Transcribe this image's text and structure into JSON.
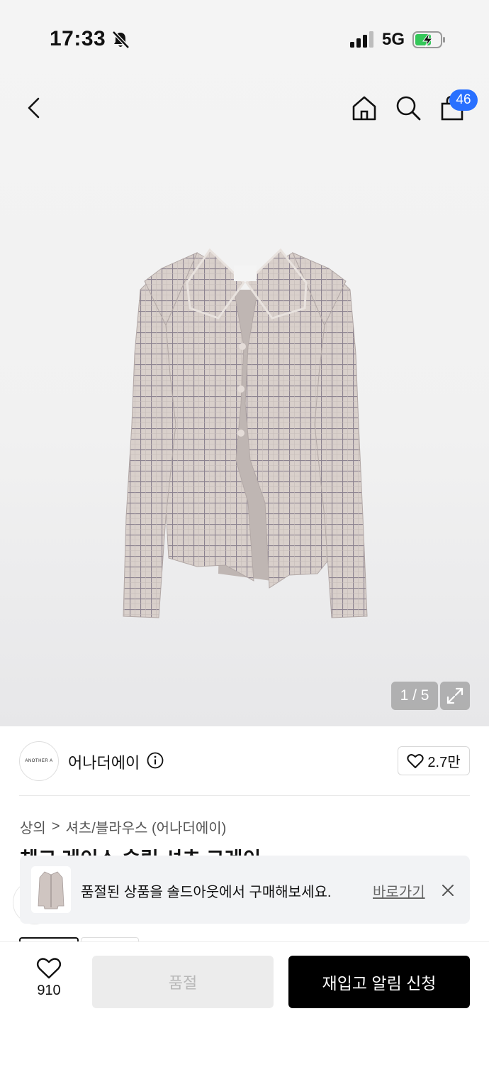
{
  "status_bar": {
    "time": "17:33",
    "network": "5G"
  },
  "header": {
    "cart_count": "46"
  },
  "gallery": {
    "counter": "1 / 5"
  },
  "brand": {
    "logo_text": "ANOTHER A",
    "name": "어나더에이",
    "like_count": "2.7만"
  },
  "breadcrumb": {
    "items": [
      "상의",
      "셔츠/블라우스 (어나더에이)"
    ],
    "separator": ">"
  },
  "product": {
    "title": "체크 레이스 슬림 셔츠 그레이"
  },
  "banner": {
    "message": "품절된 상품을 솔드아웃에서 구매해보세요.",
    "link": "바로가기"
  },
  "bottom_bar": {
    "wish_count": "910",
    "soldout_label": "품절",
    "restock_label": "재입고 알림 신청"
  },
  "colors": {
    "badge": "#2970ff",
    "primary_button": "#000000",
    "disabled_button": "#ececec"
  }
}
